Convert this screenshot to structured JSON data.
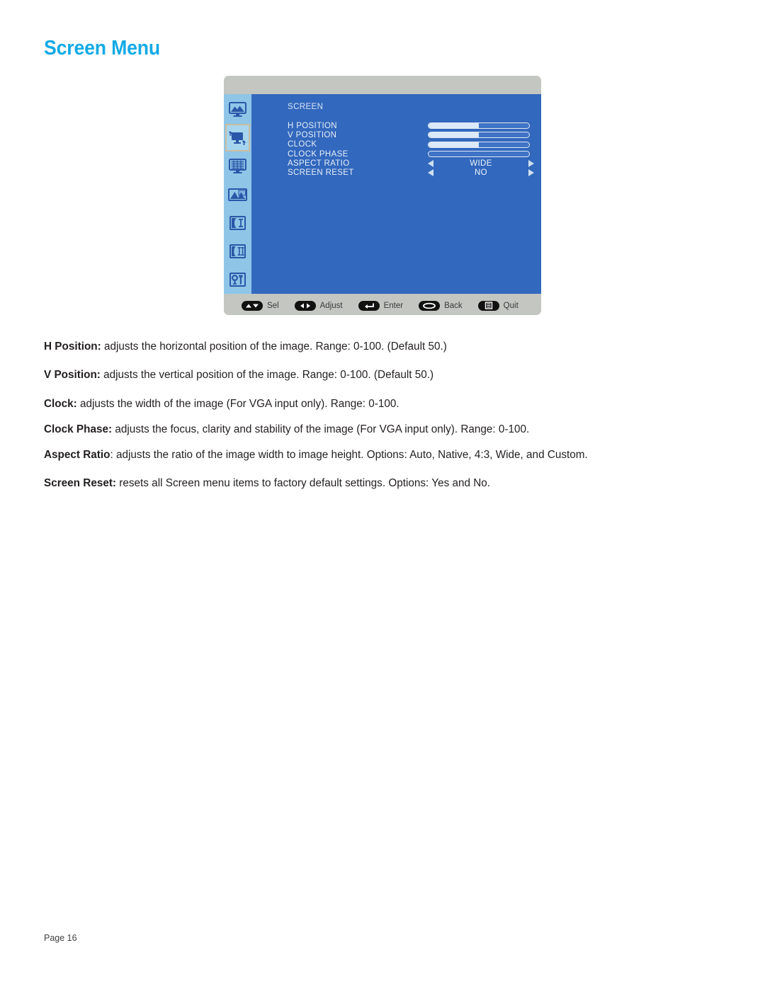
{
  "page": {
    "title": "Screen Menu",
    "footer": "Page 16"
  },
  "osd": {
    "heading": "SCREEN",
    "sidebar": [
      {
        "name": "picture-menu-icon",
        "label": "Picture",
        "selected": false
      },
      {
        "name": "screen-menu-icon",
        "label": "Screen",
        "selected": true
      },
      {
        "name": "text-menu-icon",
        "label": "Text",
        "selected": false
      },
      {
        "name": "image-menu-icon",
        "label": "Image",
        "selected": false
      },
      {
        "name": "pip-menu-icon",
        "label": "PIP",
        "selected": false
      },
      {
        "name": "pbp-menu-icon",
        "label": "PBP",
        "selected": false
      },
      {
        "name": "setup-menu-icon",
        "label": "Setup",
        "selected": false
      }
    ],
    "rows": [
      {
        "label": "H POSITION",
        "type": "slider",
        "value": "50",
        "percent": 50
      },
      {
        "label": "V POSITION",
        "type": "slider",
        "value": "50",
        "percent": 50
      },
      {
        "label": "CLOCK",
        "type": "slider",
        "value": "50",
        "percent": 50
      },
      {
        "label": "CLOCK PHASE",
        "type": "slider",
        "value": "0",
        "percent": 0
      },
      {
        "label": "ASPECT RATIO",
        "type": "selector",
        "value": "WIDE"
      },
      {
        "label": "SCREEN RESET",
        "type": "selector",
        "value": "NO"
      }
    ],
    "hints": [
      {
        "icon": "up-down-arrows-icon",
        "label": "Sel"
      },
      {
        "icon": "left-right-arrows-icon",
        "label": "Adjust"
      },
      {
        "icon": "enter-arrow-icon",
        "label": "Enter"
      },
      {
        "icon": "oval-button-icon",
        "label": "Back"
      },
      {
        "icon": "menu-list-icon",
        "label": "Quit"
      }
    ],
    "colors": {
      "panel_bg": "#3268bd",
      "sidebar_bg": "#8fc6e8",
      "chrome_bg": "#c3c6c1",
      "selection_border": "#c9bda2",
      "slider_fill": "#dbe9f8",
      "title_accent": "#14aae6"
    }
  },
  "descriptions": [
    {
      "term": "H Position:",
      "text": " adjusts the horizontal position of the image. Range: 0-100. (Default 50.)"
    },
    {
      "term": "V Position:",
      "text": " adjusts the vertical position of the image. Range: 0-100. (Default 50.)"
    },
    {
      "term": "Clock:",
      "text": " adjusts the width of the image (For VGA input only). Range: 0-100."
    },
    {
      "term": "Clock Phase:",
      "text": " adjusts the focus, clarity and stability of the image (For VGA input only). Range: 0-100."
    },
    {
      "term": "Aspect Ratio",
      "text": ": adjusts the ratio of the image width to image height. Options: Auto, Native, 4:3, Wide, and Custom."
    },
    {
      "term": "Screen Reset:",
      "text": " resets all Screen menu items to factory default settings. Options: Yes and No."
    }
  ]
}
